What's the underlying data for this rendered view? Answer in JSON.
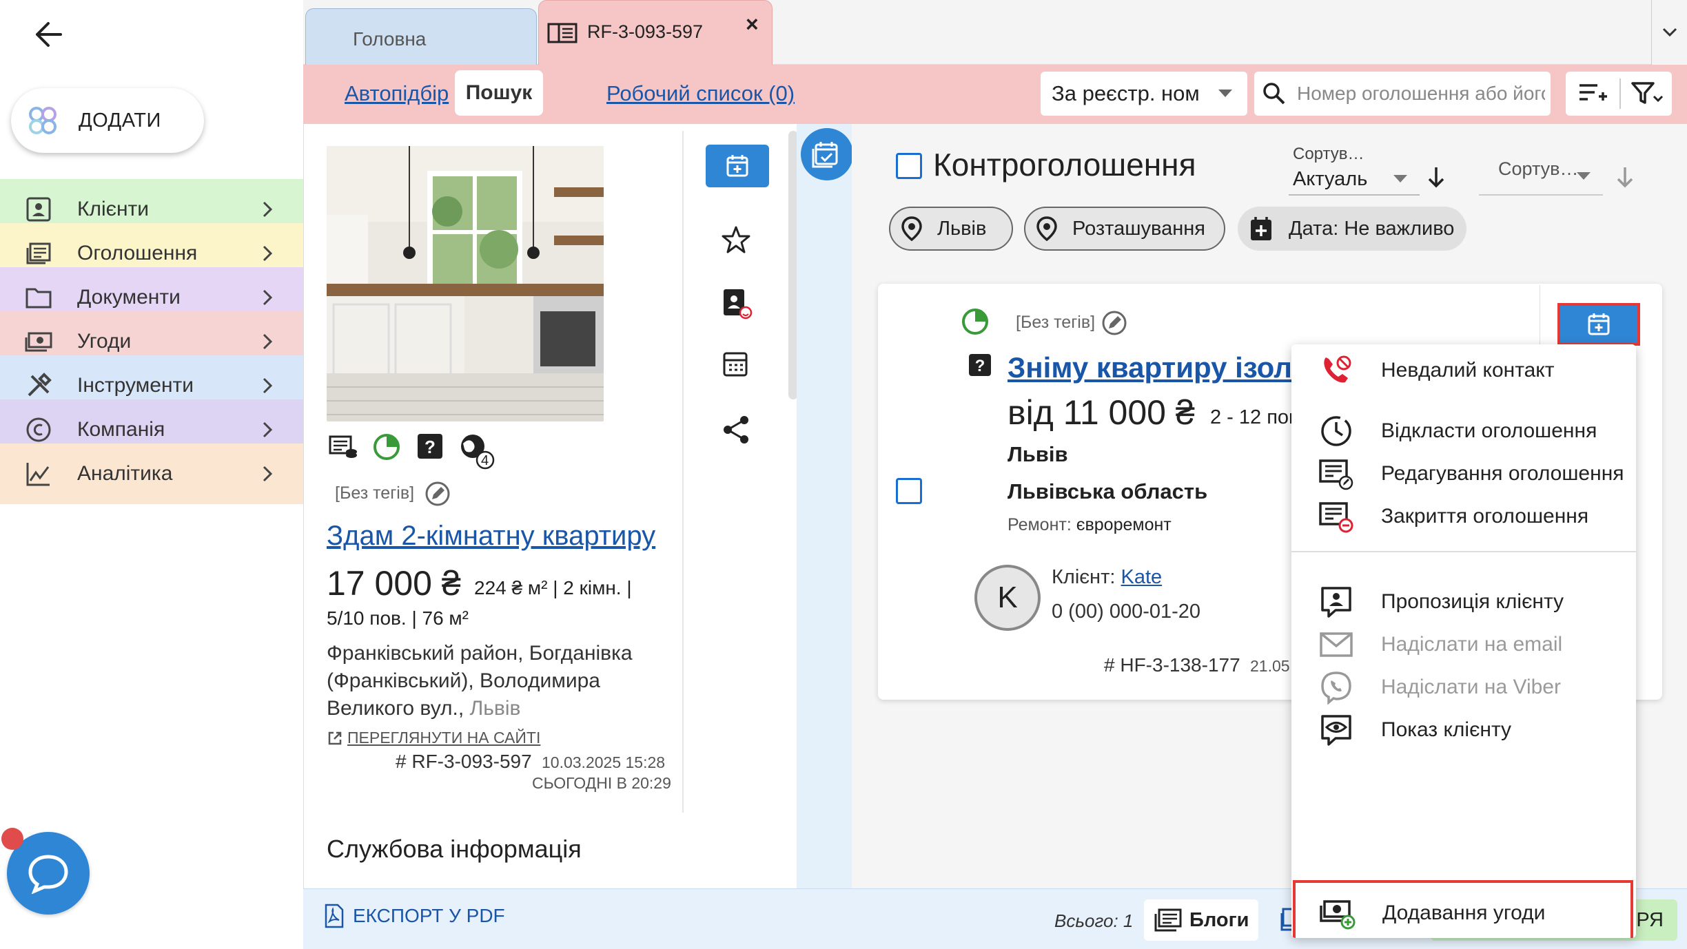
{
  "sidebar": {
    "add_label": "ДОДАТИ",
    "items": [
      {
        "label": "Клієнти",
        "color": "#d6f5d0",
        "icon": "contacts-icon"
      },
      {
        "label": "Оголошення",
        "color": "#fbf5c9",
        "icon": "listings-icon"
      },
      {
        "label": "Документи",
        "color": "#e5d6f6",
        "icon": "folder-icon"
      },
      {
        "label": "Угоди",
        "color": "#f6d4d4",
        "icon": "money-icon"
      },
      {
        "label": "Інструменти",
        "color": "#d7e6f8",
        "icon": "tools-icon"
      },
      {
        "label": "Компанія",
        "color": "#ddd3f2",
        "icon": "copyright-icon"
      },
      {
        "label": "Аналітика",
        "color": "#fbe6d2",
        "icon": "analytics-icon"
      }
    ]
  },
  "tabs": {
    "home": "Головна",
    "doc": "RF-3-093-597",
    "close": "×"
  },
  "toolbar": {
    "autopick": "Автопідбір",
    "search": "Пошук",
    "worklist": "Робочий список (0)",
    "search_by": "За реєстр. ном",
    "search_placeholder": "Номер оголошення або його"
  },
  "detail": {
    "tags": "[Без тегів]",
    "title": "Здам 2-кімнатну квартиру",
    "price": "17 000 ₴",
    "price_extra": "224 ₴ м² | 2 кімн. |",
    "floor": "5/10 пов. | 76 м²",
    "address_line1": "Франківський район, Богданівка",
    "address_line2": "(Франківський), Володимира",
    "address_line3": "Великого вул.,",
    "address_city": "Львів",
    "site_link": "ПЕРЕГЛЯНУТИ НА САЙТІ",
    "id": "# RF-3-093-597",
    "date_created": "10.03.2025 15:28",
    "date_updated": "СЬОГОДНІ В 20:29",
    "globe_count": "4",
    "service_info": "Службова інформація"
  },
  "list": {
    "title": "Контроголошення",
    "sort1_label": "Сортув…",
    "sort1_value": "Актуаль",
    "sort2_label": "Сортув…",
    "chips": [
      "Львів",
      "Розташування",
      "Дата: Не важливо"
    ]
  },
  "card": {
    "tags": "[Без тегів]",
    "title": "Зніму квартиру ізольо",
    "price": "від 11 000 ₴",
    "price_extra": "2 - 12 пов",
    "city": "Львів",
    "region": "Львівська область",
    "repair_label": "Ремонт:",
    "repair_value": "євроремонт",
    "avatar_letter": "K",
    "client_label": "Клієнт:",
    "client_name": "Kate",
    "phone": "0 (00) 000-01-20",
    "id": "# HF-3-138-177",
    "date": "21.05"
  },
  "menu": {
    "items": [
      {
        "label": "Невдалий контакт",
        "icon": "failed-call-icon",
        "disabled": false
      },
      {
        "label": "Відкласти оголошення",
        "icon": "clock-icon",
        "disabled": false
      },
      {
        "label": "Редагування оголошення",
        "icon": "edit-listing-icon",
        "disabled": false
      },
      {
        "label": "Закриття оголошення",
        "icon": "close-listing-icon",
        "disabled": false
      },
      {
        "label": "Пропозиція клієнту",
        "icon": "offer-icon",
        "disabled": false
      },
      {
        "label": "Надіслати на email",
        "icon": "mail-icon",
        "disabled": true
      },
      {
        "label": "Надіслати на Viber",
        "icon": "viber-icon",
        "disabled": true
      },
      {
        "label": "Показ клієнту",
        "icon": "show-icon",
        "disabled": false
      },
      {
        "label": "Додавання угоди",
        "icon": "add-deal-icon",
        "disabled": false
      }
    ]
  },
  "bottom": {
    "export": "ЕКСПОРТ У PDF",
    "total": "Всього: 1",
    "blogs": "Блоги",
    "green_tail": "РЯ"
  },
  "colors": {
    "accent_blue": "#2f86d4",
    "link": "#1a56a8",
    "pink_toolbar": "#f6c6c6",
    "highlight_red": "#e53935"
  }
}
